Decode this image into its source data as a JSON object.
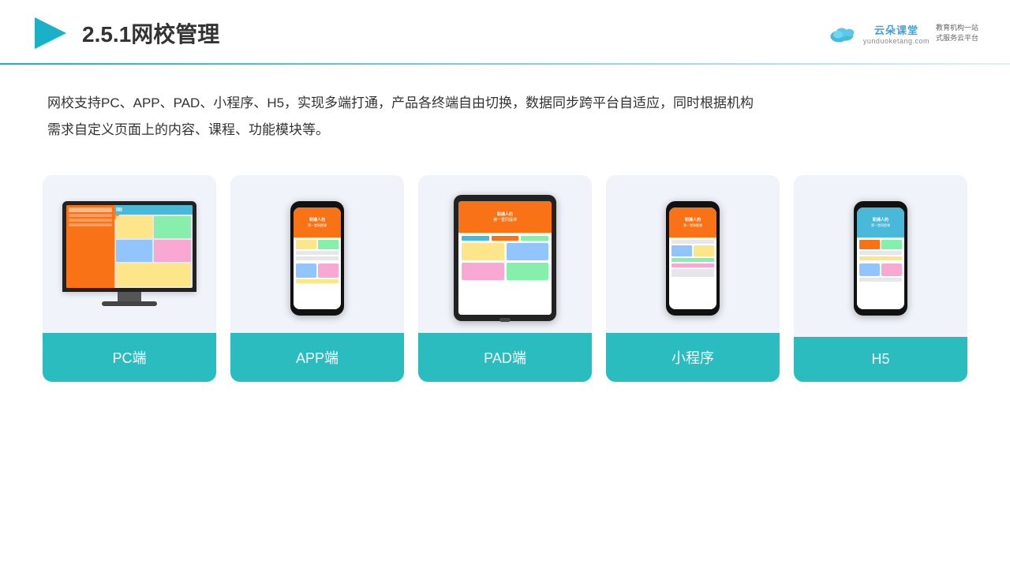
{
  "header": {
    "title": "2.5.1网校管理",
    "logo": {
      "name": "云朵课堂",
      "url_text": "yunduoketang.com",
      "tagline": "教育机构一站\n式服务云平台"
    }
  },
  "description": "网校支持PC、APP、PAD、小程序、H5，实现多端打通，产品各终端自由切换，数据同步跨平台自适应，同时根据机构\n需求自定义页面上的内容、课程、功能模块等。",
  "cards": [
    {
      "id": "pc",
      "label": "PC端",
      "type": "pc"
    },
    {
      "id": "app",
      "label": "APP端",
      "type": "phone"
    },
    {
      "id": "pad",
      "label": "PAD端",
      "type": "tablet"
    },
    {
      "id": "miniprogram",
      "label": "小程序",
      "type": "phone"
    },
    {
      "id": "h5",
      "label": "H5",
      "type": "phone"
    }
  ],
  "colors": {
    "accent": "#2bbcc0",
    "divider_start": "#1ab0c8",
    "divider_end": "#e0f0f5",
    "card_bg": "#f0f4fa",
    "orange": "#f97316",
    "text_primary": "#333"
  }
}
